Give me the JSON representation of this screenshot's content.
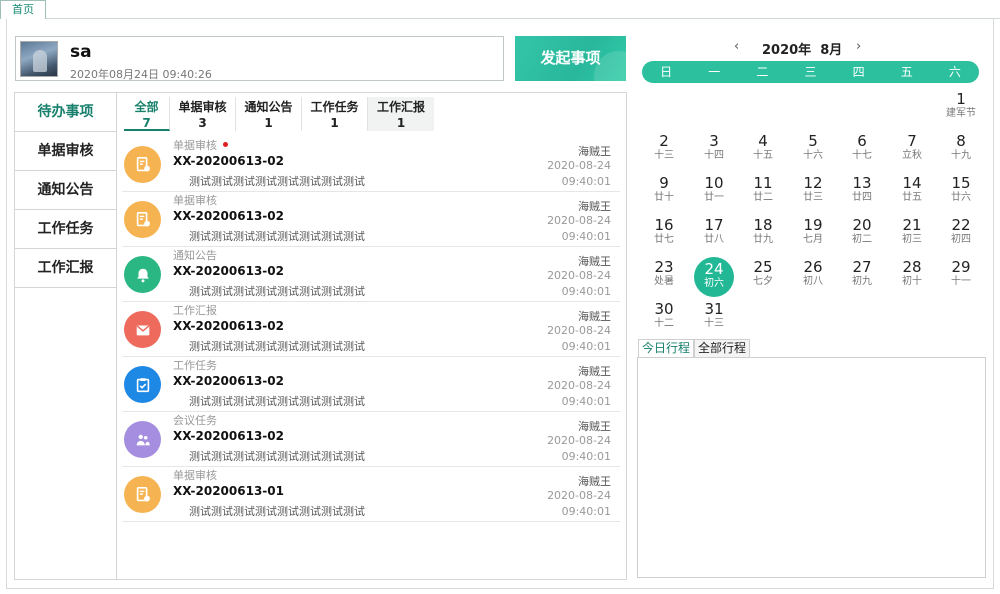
{
  "top_tab": "首页",
  "user": {
    "name": "sa",
    "datetime": "2020年08月24日  09:40:26"
  },
  "start_button": "发起事项",
  "side_nav": [
    "待办事项",
    "单据审核",
    "通知公告",
    "工作任务",
    "工作汇报"
  ],
  "tabs": [
    {
      "label": "全部",
      "count": "7"
    },
    {
      "label": "单据审核",
      "count": "3"
    },
    {
      "label": "通知公告",
      "count": "1"
    },
    {
      "label": "工作任务",
      "count": "1"
    },
    {
      "label": "工作汇报",
      "count": "1"
    }
  ],
  "items": [
    {
      "type": "单据审核",
      "unread": true,
      "code": "XX-20200613-02",
      "desc": "测试测试测试测试测试测试测试测试",
      "author": "海贼王",
      "date": "2020-08-24",
      "time": "09:40:01",
      "icon": "document-check-icon",
      "color": "#f5b451"
    },
    {
      "type": "单据审核",
      "unread": false,
      "code": "XX-20200613-02",
      "desc": "测试测试测试测试测试测试测试测试",
      "author": "海贼王",
      "date": "2020-08-24",
      "time": "09:40:01",
      "icon": "document-check-icon",
      "color": "#f5b451"
    },
    {
      "type": "通知公告",
      "unread": false,
      "code": "XX-20200613-02",
      "desc": "测试测试测试测试测试测试测试测试",
      "author": "海贼王",
      "date": "2020-08-24",
      "time": "09:40:01",
      "icon": "bell-icon",
      "color": "#2ab783"
    },
    {
      "type": "工作汇报",
      "unread": false,
      "code": "XX-20200613-02",
      "desc": "测试测试测试测试测试测试测试测试",
      "author": "海贼王",
      "date": "2020-08-24",
      "time": "09:40:01",
      "icon": "mail-icon",
      "color": "#ee6a5c"
    },
    {
      "type": "工作任务",
      "unread": false,
      "code": "XX-20200613-02",
      "desc": "测试测试测试测试测试测试测试测试",
      "author": "海贼王",
      "date": "2020-08-24",
      "time": "09:40:01",
      "icon": "clipboard-check-icon",
      "color": "#1e88e5"
    },
    {
      "type": "会议任务",
      "unread": false,
      "code": "XX-20200613-02",
      "desc": "测试测试测试测试测试测试测试测试",
      "author": "海贼王",
      "date": "2020-08-24",
      "time": "09:40:01",
      "icon": "meeting-icon",
      "color": "#a58ee0"
    },
    {
      "type": "单据审核",
      "unread": false,
      "code": "XX-20200613-01",
      "desc": "测试测试测试测试测试测试测试测试",
      "author": "海贼王",
      "date": "2020-08-24",
      "time": "09:40:01",
      "icon": "document-check-icon",
      "color": "#f5b451"
    }
  ],
  "calendar": {
    "year_label": "2020年",
    "month_label": "8月",
    "weekdays": [
      "日",
      "一",
      "二",
      "三",
      "四",
      "五",
      "六"
    ],
    "first_weekday": 6,
    "today": 24,
    "days": [
      {
        "d": "1",
        "l": "建军节"
      },
      {
        "d": "2",
        "l": "十三"
      },
      {
        "d": "3",
        "l": "十四"
      },
      {
        "d": "4",
        "l": "十五"
      },
      {
        "d": "5",
        "l": "十六"
      },
      {
        "d": "6",
        "l": "十七"
      },
      {
        "d": "7",
        "l": "立秋"
      },
      {
        "d": "8",
        "l": "十九"
      },
      {
        "d": "9",
        "l": "廿十"
      },
      {
        "d": "10",
        "l": "廿一"
      },
      {
        "d": "11",
        "l": "廿二"
      },
      {
        "d": "12",
        "l": "廿三"
      },
      {
        "d": "13",
        "l": "廿四"
      },
      {
        "d": "14",
        "l": "廿五"
      },
      {
        "d": "15",
        "l": "廿六"
      },
      {
        "d": "16",
        "l": "廿七"
      },
      {
        "d": "17",
        "l": "廿八"
      },
      {
        "d": "18",
        "l": "廿九"
      },
      {
        "d": "19",
        "l": "七月"
      },
      {
        "d": "20",
        "l": "初二"
      },
      {
        "d": "21",
        "l": "初三"
      },
      {
        "d": "22",
        "l": "初四"
      },
      {
        "d": "23",
        "l": "处暑"
      },
      {
        "d": "24",
        "l": "初六"
      },
      {
        "d": "25",
        "l": "七夕"
      },
      {
        "d": "26",
        "l": "初八"
      },
      {
        "d": "27",
        "l": "初九"
      },
      {
        "d": "28",
        "l": "初十"
      },
      {
        "d": "29",
        "l": "十一"
      },
      {
        "d": "30",
        "l": "十二"
      },
      {
        "d": "31",
        "l": "十三"
      }
    ]
  },
  "schedule_tabs": [
    "今日行程",
    "全部行程"
  ],
  "accent_color": "#2cc09e"
}
